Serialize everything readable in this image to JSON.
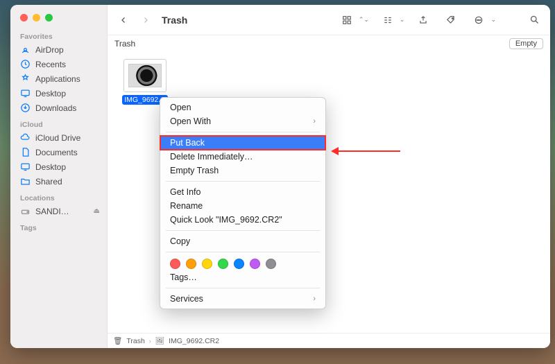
{
  "window_title": "Trash",
  "location_label": "Trash",
  "empty_button": "Empty",
  "sidebar": {
    "sections": [
      {
        "header": "Favorites",
        "items": [
          {
            "icon": "airdrop",
            "label": "AirDrop"
          },
          {
            "icon": "recents",
            "label": "Recents"
          },
          {
            "icon": "apps",
            "label": "Applications"
          },
          {
            "icon": "desktop",
            "label": "Desktop"
          },
          {
            "icon": "downloads",
            "label": "Downloads"
          }
        ]
      },
      {
        "header": "iCloud",
        "items": [
          {
            "icon": "iclouddrive",
            "label": "iCloud Drive"
          },
          {
            "icon": "documents",
            "label": "Documents"
          },
          {
            "icon": "desktop",
            "label": "Desktop"
          },
          {
            "icon": "shared",
            "label": "Shared"
          }
        ]
      },
      {
        "header": "Locations",
        "items": [
          {
            "icon": "disk",
            "label": "SANDI…",
            "eject": true
          }
        ]
      },
      {
        "header": "Tags",
        "items": []
      }
    ]
  },
  "file": {
    "name": "IMG_9692.CR2",
    "label_truncated": "IMG_9692.C"
  },
  "context_menu": {
    "items": [
      {
        "type": "item",
        "label": "Open"
      },
      {
        "type": "item",
        "label": "Open With",
        "submenu": true
      },
      {
        "type": "sep"
      },
      {
        "type": "item",
        "label": "Put Back",
        "highlighted": true
      },
      {
        "type": "item",
        "label": "Delete Immediately…"
      },
      {
        "type": "item",
        "label": "Empty Trash"
      },
      {
        "type": "sep"
      },
      {
        "type": "item",
        "label": "Get Info"
      },
      {
        "type": "item",
        "label": "Rename"
      },
      {
        "type": "item",
        "label": "Quick Look \"IMG_9692.CR2\""
      },
      {
        "type": "sep"
      },
      {
        "type": "item",
        "label": "Copy"
      },
      {
        "type": "sep"
      },
      {
        "type": "tags",
        "colors": [
          "#ff5b58",
          "#ff9f0a",
          "#ffd60a",
          "#32d74b",
          "#0a84ff",
          "#bf5af2",
          "#8e8e93"
        ]
      },
      {
        "type": "item",
        "label": "Tags…"
      },
      {
        "type": "sep"
      },
      {
        "type": "item",
        "label": "Services",
        "submenu": true
      }
    ]
  },
  "pathbar": {
    "location": "Trash",
    "file": "IMG_9692.CR2"
  }
}
